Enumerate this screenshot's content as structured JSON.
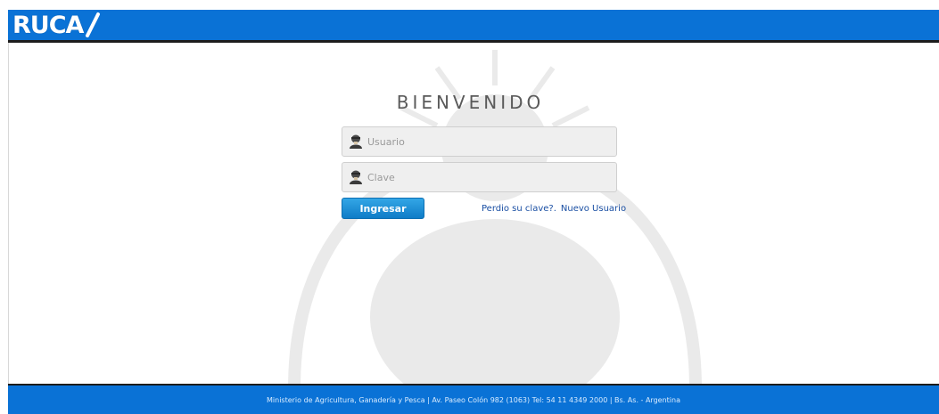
{
  "header": {
    "logo_text": "RUCA"
  },
  "login": {
    "title": "BIENVENIDO",
    "user_placeholder": "Usuario",
    "password_placeholder": "Clave",
    "submit_label": "Ingresar",
    "forgot_label": "Perdio su clave?.",
    "new_user_label": "Nuevo Usuario"
  },
  "footer": {
    "text": "Ministerio de Agricultura, Ganadería y Pesca | Av. Paseo Colón 982 (1063) Tel: 54 11 4349 2000 | Bs. As. - Argentina"
  },
  "colors": {
    "brand_blue": "#0a72d6",
    "button_blue": "#1f8fd6",
    "link_blue": "#1a4fa3"
  }
}
